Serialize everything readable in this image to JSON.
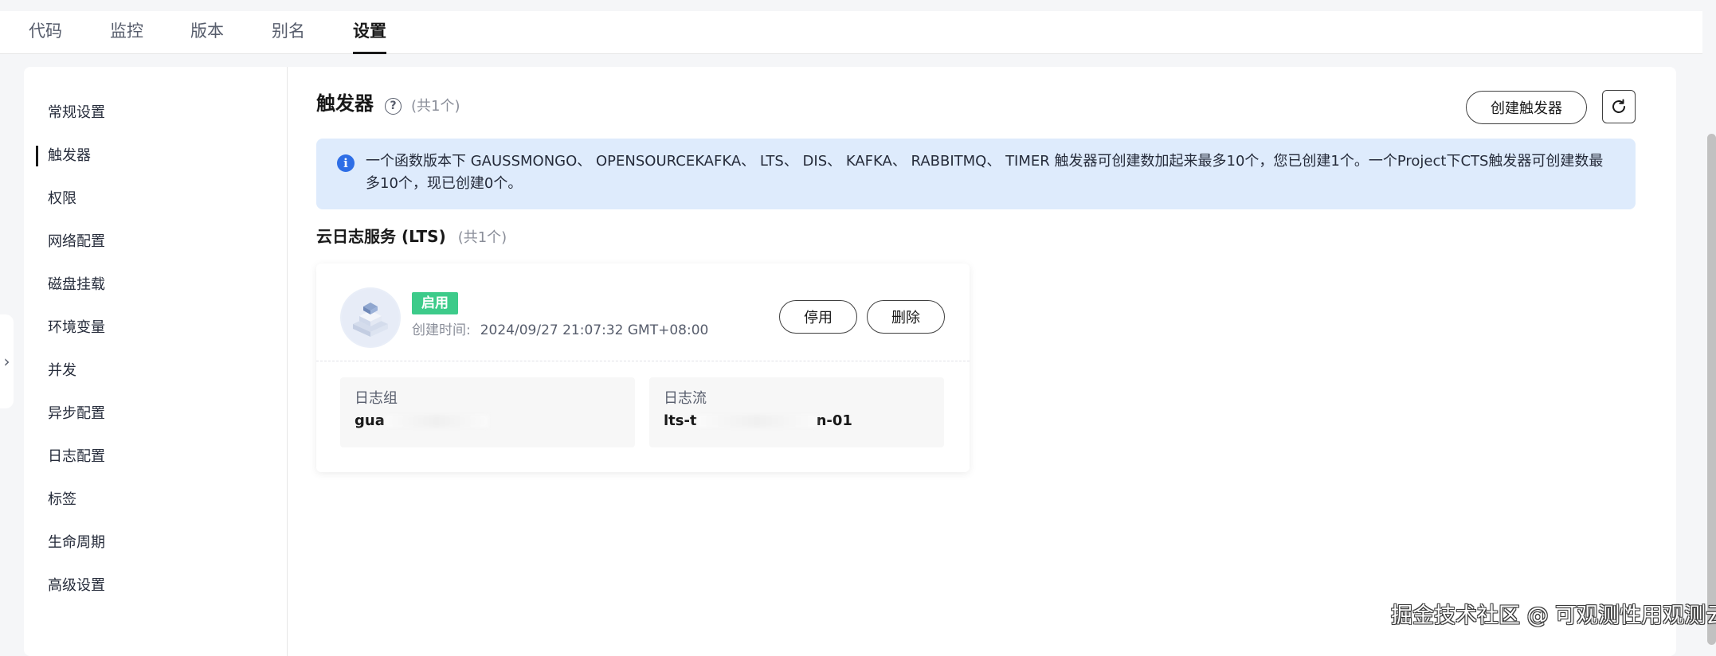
{
  "tabs": [
    {
      "label": "代码",
      "active": false
    },
    {
      "label": "监控",
      "active": false
    },
    {
      "label": "版本",
      "active": false
    },
    {
      "label": "别名",
      "active": false
    },
    {
      "label": "设置",
      "active": true
    }
  ],
  "sidebar": {
    "items": [
      {
        "label": "常规设置",
        "active": false
      },
      {
        "label": "触发器",
        "active": true
      },
      {
        "label": "权限",
        "active": false
      },
      {
        "label": "网络配置",
        "active": false
      },
      {
        "label": "磁盘挂载",
        "active": false
      },
      {
        "label": "环境变量",
        "active": false
      },
      {
        "label": "并发",
        "active": false
      },
      {
        "label": "异步配置",
        "active": false
      },
      {
        "label": "日志配置",
        "active": false
      },
      {
        "label": "标签",
        "active": false
      },
      {
        "label": "生命周期",
        "active": false
      },
      {
        "label": "高级设置",
        "active": false
      }
    ]
  },
  "main": {
    "title": "触发器",
    "help_icon": "question-circle-icon",
    "count": "(共1个)",
    "create_button": "创建触发器",
    "refresh_icon": "refresh-icon",
    "alert": {
      "icon": "info-icon",
      "text": "一个函数版本下 GAUSSMONGO、 OPENSOURCEKAFKA、 LTS、 DIS、 KAFKA、 RABBITMQ、 TIMER 触发器可创建数加起来最多10个，您已创建1个。一个Project下CTS触发器可创建数最多10个，现已创建0个。"
    },
    "section": {
      "title": "云日志服务 (LTS)",
      "count": "(共1个)"
    },
    "card": {
      "status": "启用",
      "created_label": "创建时间:",
      "created_value": "2024/09/27 21:07:32 GMT+08:00",
      "disable_button": "停用",
      "delete_button": "删除",
      "log_group_label": "日志组",
      "log_group_prefix": "gua",
      "log_stream_label": "日志流",
      "log_stream_prefix": "lts-t",
      "log_stream_suffix": "n-01"
    }
  },
  "watermark": "掘金技术社区 @ 可观测性用观测云",
  "colors": {
    "accent": "#191919",
    "status_green": "#3dcb8a",
    "alert_bg": "#deebfc",
    "info_blue": "#2e6ee6"
  }
}
